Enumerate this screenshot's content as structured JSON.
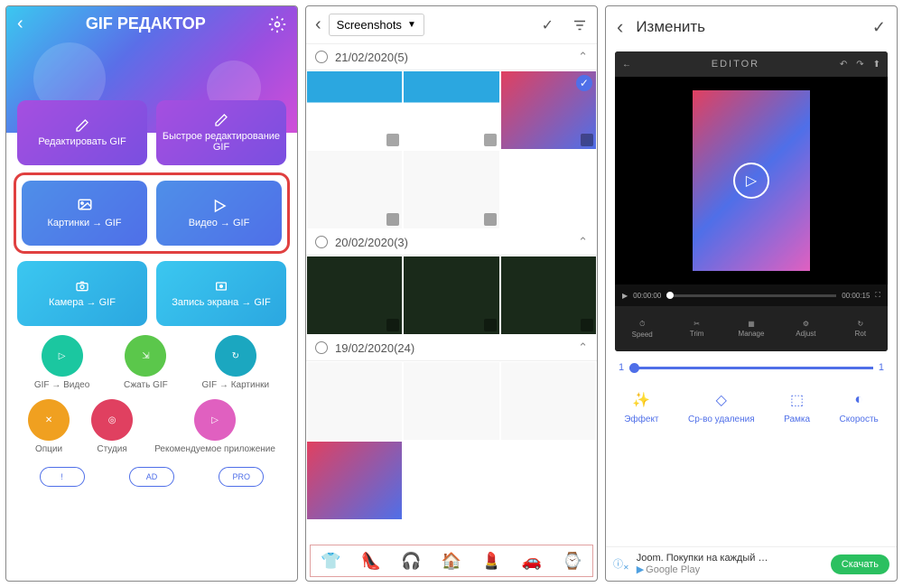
{
  "p1": {
    "title": "GIF РЕДАКТОР",
    "edit": "Редактировать GIF",
    "quick": "Быстрое редактирование GIF",
    "pics": "Картинки → GIF",
    "video": "Видео → GIF",
    "camera": "Камера → GIF",
    "screen": "Запись экрана → GIF",
    "toVideo": "GIF → Видео",
    "compress": "Сжать GIF",
    "toPics": "GIF → Картинки",
    "options": "Опции",
    "studio": "Студия",
    "recommend": "Рекомендуемое приложение",
    "pillInfo": "!",
    "pillAd": "AD",
    "pillPro": "PRO"
  },
  "p2": {
    "folder": "Screenshots",
    "date1": "21/02/2020(5)",
    "date2": "20/02/2020(3)",
    "date3": "19/02/2020(24)"
  },
  "p3": {
    "title": "Изменить",
    "editor": "EDITOR",
    "t0": "00:00:00",
    "t1": "00:00:15",
    "speed": "Speed",
    "trim": "Trim",
    "manage": "Manage",
    "adjust": "Adjust",
    "rot": "Rot",
    "sMin": "1",
    "sMax": "1",
    "effect": "Эффект",
    "remove": "Ср-во удаления",
    "frame": "Рамка",
    "spd": "Скорость",
    "adTitle": "Joom. Покупки на каждый …",
    "adStore": "Google Play",
    "adBtn": "Скачать"
  }
}
